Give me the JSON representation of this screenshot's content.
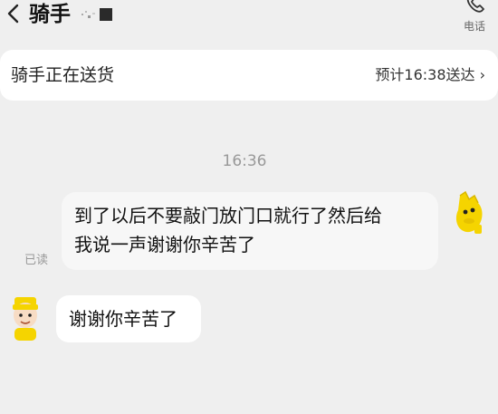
{
  "header": {
    "title": "骑手",
    "back_icon": "chevron-left-icon",
    "call_icon": "phone-icon",
    "call_label": "电话"
  },
  "status": {
    "text": "骑手正在送货",
    "eta": "预计16:38送达 ›"
  },
  "chat": {
    "timestamp": "16:36",
    "messages": [
      {
        "from": "me",
        "lines": [
          "到了以后不要敲门放门口就行了然后给",
          "我说一声谢谢你辛苦了"
        ],
        "receipt": "已读"
      },
      {
        "from": "rider",
        "text": "谢谢你辛苦了"
      }
    ]
  },
  "colors": {
    "background": "#efefef",
    "card": "#ffffff",
    "avatar_accent": "#f5d400"
  }
}
